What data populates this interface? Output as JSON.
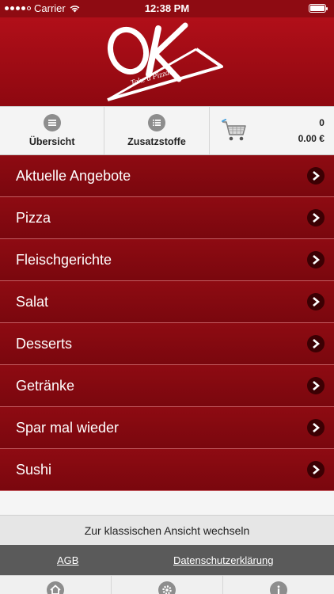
{
  "status_bar": {
    "carrier": "Carrier",
    "time": "12:38 PM"
  },
  "header": {
    "logo_text": "OK",
    "tagline": "Take a Pizza..."
  },
  "toolbar": {
    "overview_label": "Übersicht",
    "additives_label": "Zusatzstoffe",
    "cart_count": "0",
    "cart_total": "0.00 €"
  },
  "menu": {
    "items": [
      {
        "label": "Aktuelle Angebote"
      },
      {
        "label": "Pizza"
      },
      {
        "label": "Fleischgerichte"
      },
      {
        "label": "Salat"
      },
      {
        "label": "Desserts"
      },
      {
        "label": "Getränke"
      },
      {
        "label": "Spar mal wieder"
      },
      {
        "label": "Sushi"
      }
    ]
  },
  "footer": {
    "classic_view_label": "Zur klassischen Ansicht wechseln",
    "agb_label": "AGB",
    "privacy_label": "Datenschutzerklärung"
  },
  "tabbar": {
    "icons": [
      "home-icon",
      "gear-icon",
      "info-icon"
    ]
  },
  "colors": {
    "brand_red": "#8e0b12",
    "header_red": "#b10f19",
    "chevron_bg": "#3b0003",
    "legal_bar": "#5a5a5a"
  }
}
